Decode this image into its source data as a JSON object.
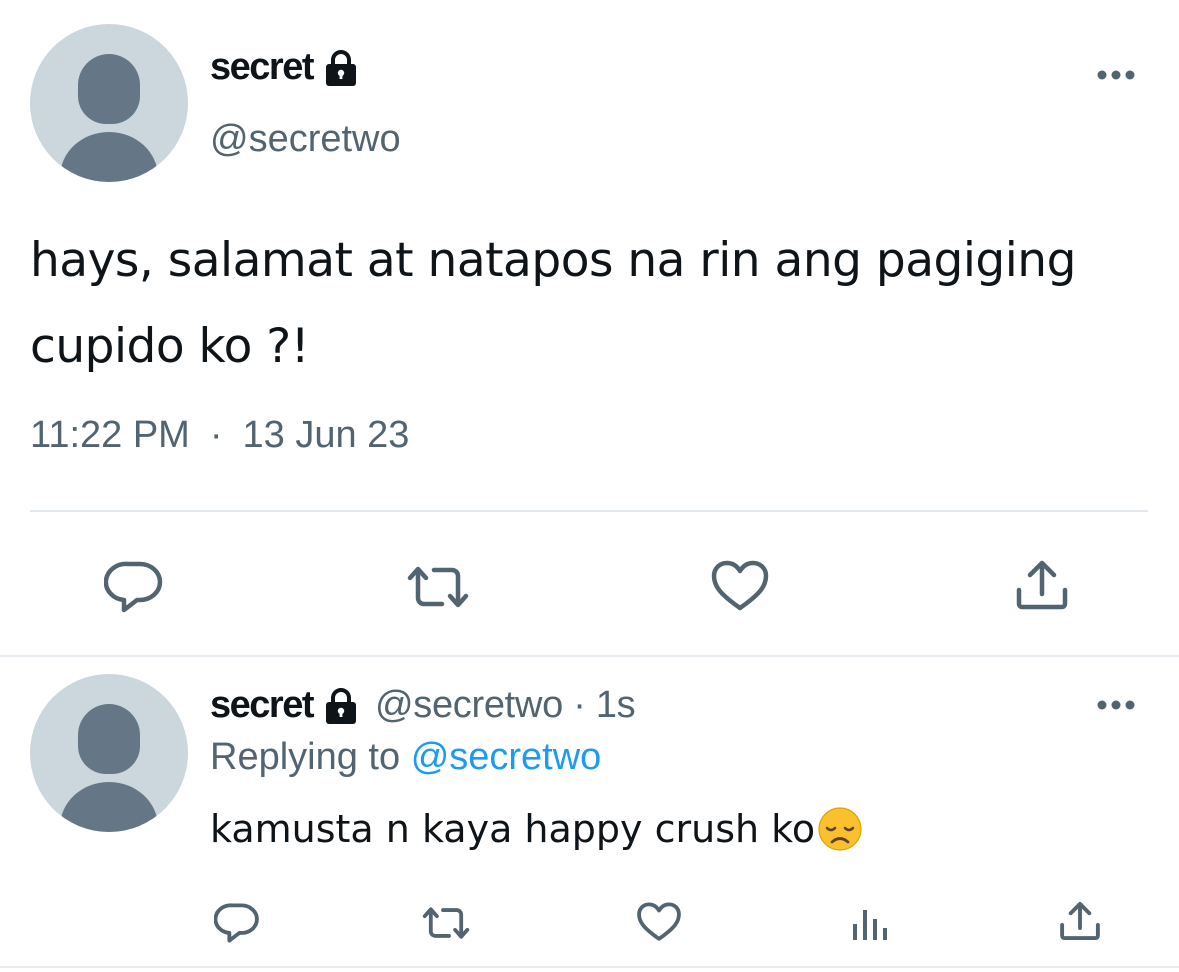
{
  "main_tweet": {
    "display_name": "secret",
    "handle": "@secretwo",
    "text": "hays, salamat at natapos na rin ang pagiging cupido ko ?!",
    "time": "11:22 PM",
    "separator": "·",
    "date": "13 Jun 23",
    "icons": {
      "avatar": "default-avatar-icon",
      "lock": "lock-icon",
      "more": "more-options-icon",
      "reply": "reply-icon",
      "retweet": "retweet-icon",
      "like": "like-icon",
      "share": "share-icon"
    }
  },
  "reply_tweet": {
    "display_name": "secret",
    "handle": "@secretwo",
    "separator": "·",
    "age": "1s",
    "replying_prefix": "Replying to",
    "replying_to": "@secretwo",
    "text": "kamusta n kaya happy crush ko",
    "emoji": "disappointed-face",
    "icons": {
      "reply": "reply-icon",
      "retweet": "retweet-icon",
      "like": "like-icon",
      "views": "views-icon",
      "share": "share-icon"
    }
  },
  "colors": {
    "text_primary": "#0f1419",
    "text_secondary": "#536471",
    "link": "#1d9bf0",
    "avatar_bg": "#ccd6dd",
    "avatar_fg": "#657786",
    "icon": "#536471",
    "divider": "#e1e8ed"
  }
}
